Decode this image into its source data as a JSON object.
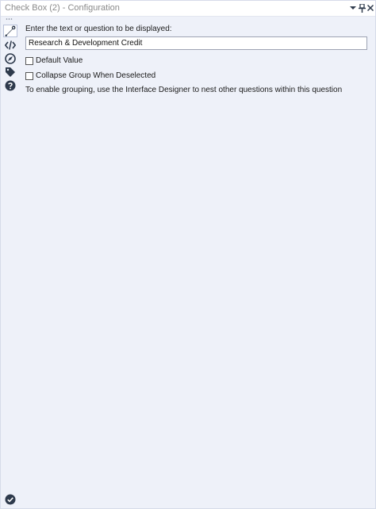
{
  "window": {
    "title": "Check Box (2) - Configuration",
    "controls": [
      "dropdown-icon",
      "pin-icon",
      "close-icon"
    ]
  },
  "sidebar": {
    "items": [
      {
        "icon": "wrench-icon",
        "active": true
      },
      {
        "icon": "code-icon",
        "active": false
      },
      {
        "icon": "compass-icon",
        "active": false
      },
      {
        "icon": "tag-icon",
        "active": false
      },
      {
        "icon": "help-icon",
        "active": false
      }
    ]
  },
  "form": {
    "prompt_label": "Enter the text or question to be displayed:",
    "prompt_value": "Research & Development Credit",
    "default_value_label": "Default Value",
    "default_value_checked": false,
    "collapse_label": "Collapse Group When Deselected",
    "collapse_checked": false,
    "hint": "To enable grouping, use the Interface Designer to nest other questions within this question"
  },
  "footer": {
    "ok_icon": "check-circle-icon"
  },
  "colors": {
    "panel_bg": "#eef1f9",
    "icon_dark": "#2e3a4c"
  }
}
